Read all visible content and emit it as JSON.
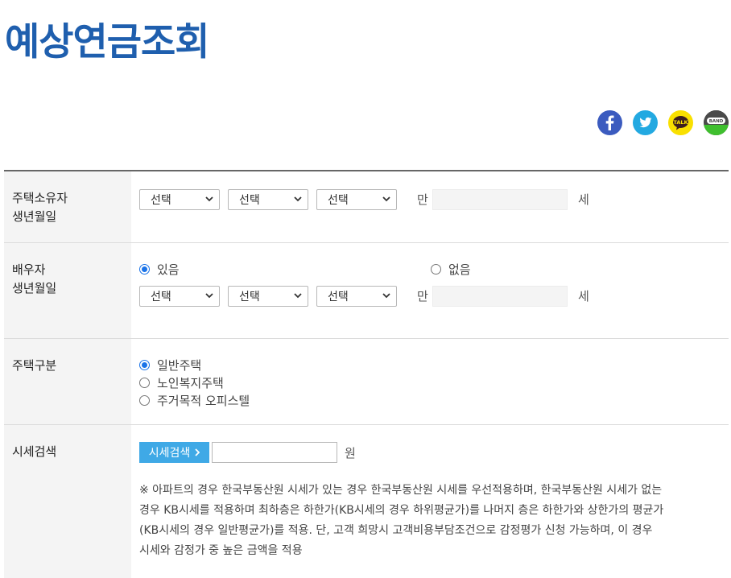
{
  "page": {
    "title": "예상연금조회"
  },
  "share": [
    {
      "name": "facebook",
      "icon": "facebook-icon",
      "color": "#3b5bbf"
    },
    {
      "name": "twitter",
      "icon": "twitter-icon",
      "color": "#23a9e1"
    },
    {
      "name": "kakaotalk",
      "icon": "kakaotalk-icon",
      "color": "#f9e000",
      "text": "TALK"
    },
    {
      "name": "band",
      "icon": "band-icon",
      "color": "#3fbf2e",
      "text": "BAND"
    }
  ],
  "owner": {
    "label_line1": "주택소유자",
    "label_line2": "생년월일",
    "year": "선택",
    "month": "선택",
    "day": "선택",
    "age_prefix": "만",
    "age_value": "",
    "age_suffix": "세"
  },
  "spouse": {
    "label_line1": "배우자",
    "label_line2": "생년월일",
    "options": [
      {
        "label": "있음",
        "checked": true
      },
      {
        "label": "없음",
        "checked": false
      }
    ],
    "year": "선택",
    "month": "선택",
    "day": "선택",
    "age_prefix": "만",
    "age_value": "",
    "age_suffix": "세"
  },
  "house_type": {
    "label": "주택구분",
    "options": [
      {
        "label": "일반주택",
        "checked": true
      },
      {
        "label": "노인복지주택",
        "checked": false
      },
      {
        "label": "주거목적 오피스텔",
        "checked": false
      }
    ]
  },
  "price": {
    "label": "시세검색",
    "button": "시세검색",
    "value": "",
    "unit": "원",
    "note_lines": [
      "※ 아파트의 경우 한국부동산원 시세가 있는 경우 한국부동산원 시세를 우선적용하며, 한국부동산원 시세가 없는",
      "경우 KB시세를 적용하며 최하층은 하한가(KB시세의 경우 하위평균가)를 나머지 층은 하한가와 상한가의 평균가",
      "(KB시세의 경우 일반평균가)를 적용. 단, 고객 희망시 고객비용부담조건으로 감정평가 신청 가능하며, 이 경우",
      "시세와 감정가 중 높은 금액을 적용"
    ]
  },
  "colors": {
    "title": "#1f5fae",
    "accent_button": "#3fa9e6",
    "radio_checked": "#1a73e8",
    "label_bg": "#f4f4f4"
  }
}
